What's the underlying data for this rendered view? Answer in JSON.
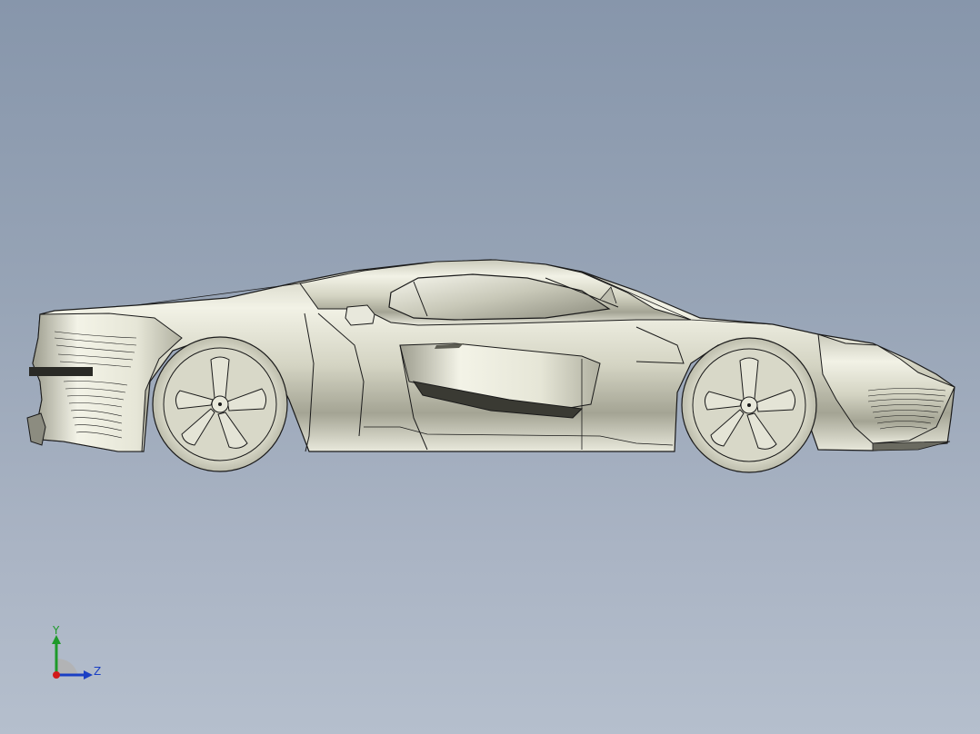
{
  "viewport": {
    "background_top": "#8796ab",
    "background_bottom": "#b5bfcd"
  },
  "model": {
    "body_color": "#d9d9c9",
    "body_highlight": "#f4f4ea",
    "body_shadow": "#5c5c52",
    "line_color": "#1a1a1a"
  },
  "triad": {
    "y_label": "Y",
    "z_label": "Z",
    "y_color": "#1e9a2a",
    "z_color": "#1a3fc4",
    "x_color": "#d11a1a"
  }
}
